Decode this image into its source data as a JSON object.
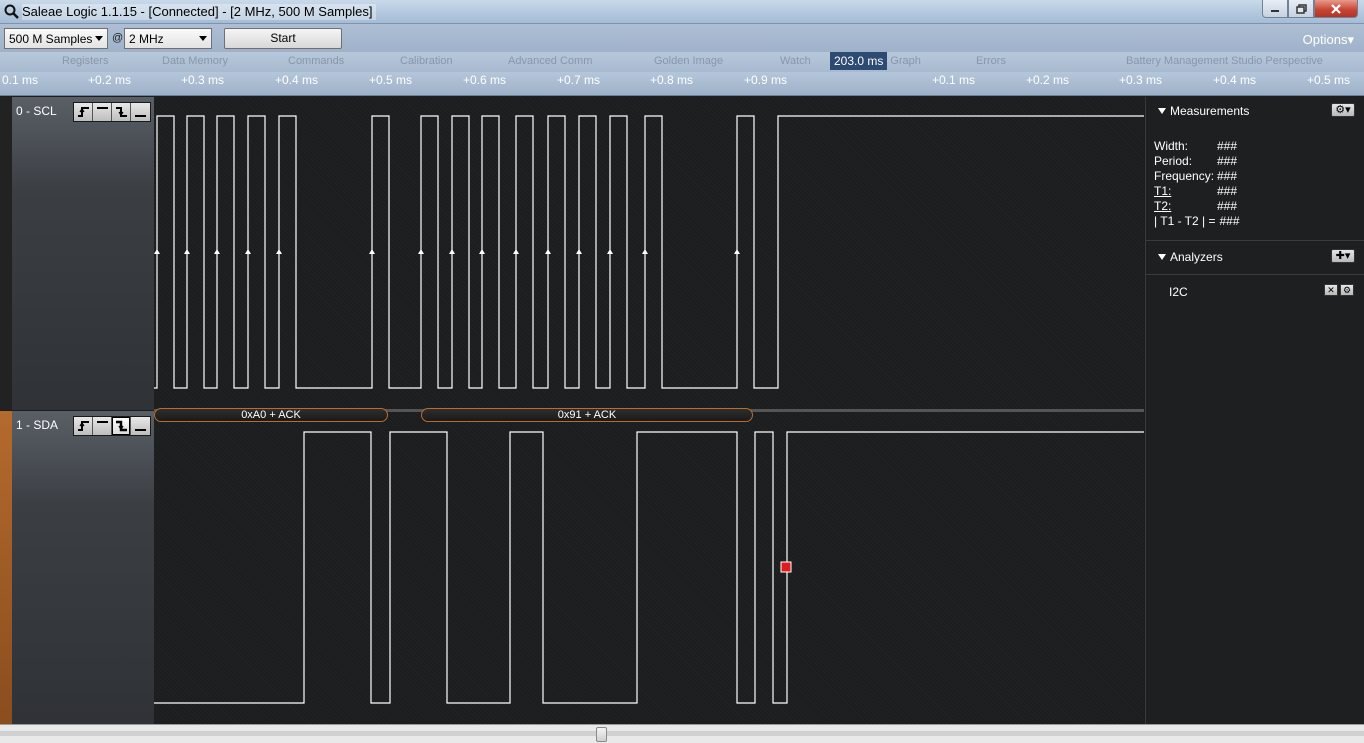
{
  "window": {
    "title": "Saleae Logic 1.1.15 - [Connected] - [2 MHz, 500 M Samples]"
  },
  "toolbar": {
    "samples": "500 M Samples",
    "at": "@",
    "rate": "2 MHz",
    "start_label": "Start",
    "options_label": "Options▾"
  },
  "ghost_toolbar": [
    "Registers",
    "Data Memory",
    "Commands",
    "Calibration",
    "Advanced Comm",
    "Golden Image",
    "Watch",
    "Data Graph",
    "Errors",
    "Battery Management Studio Perspective"
  ],
  "ruler": {
    "ticks": [
      "0.1 ms",
      "+0.2 ms",
      "+0.3 ms",
      "+0.4 ms",
      "+0.5 ms",
      "+0.6 ms",
      "+0.7 ms",
      "+0.8 ms",
      "+0.9 ms",
      "+0.1 ms",
      "+0.2 ms",
      "+0.3 ms",
      "+0.4 ms",
      "+0.5 ms"
    ],
    "cursor": "203.0 ms"
  },
  "channels": [
    {
      "name": "0 - SCL"
    },
    {
      "name": "1 - SDA"
    }
  ],
  "protocol": [
    "0xA0 + ACK",
    "0x91 + ACK"
  ],
  "measurements": {
    "title": "Measurements",
    "rows": [
      {
        "label": "Width:",
        "value": "###"
      },
      {
        "label": "Period:",
        "value": "###"
      },
      {
        "label": "Frequency:",
        "value": "###"
      },
      {
        "label": "T1:",
        "value": "###"
      },
      {
        "label": "T2:",
        "value": "###"
      },
      {
        "label": "| T1 - T2 | =",
        "value": "###"
      }
    ]
  },
  "analyzers": {
    "title": "Analyzers",
    "items": [
      {
        "name": "I2C"
      }
    ]
  },
  "colors": {
    "accent": "#b86d2c",
    "marker": "#e01b1b",
    "wave": "#ffffff"
  }
}
